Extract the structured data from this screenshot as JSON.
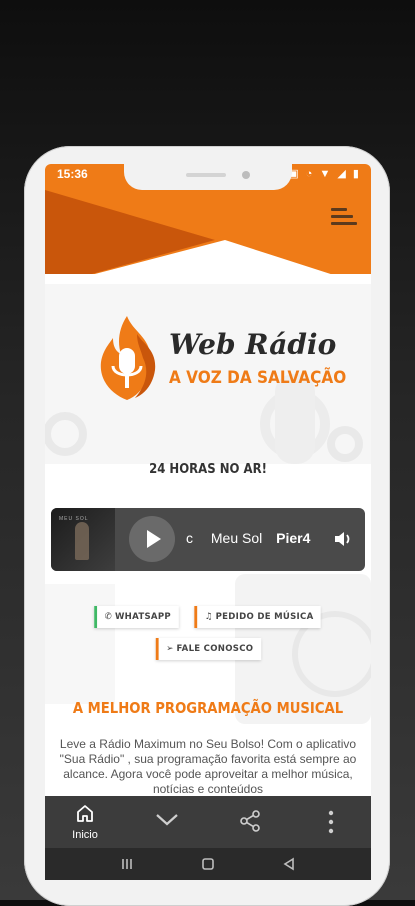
{
  "statusbar": {
    "time": "15:36",
    "icons": "▣ ◔ ▼ ◢ ▮"
  },
  "logo": {
    "title": "Web Rádio",
    "subtitle": "A VOZ DA SALVAÇÃO"
  },
  "tagline": "24 HORAS NO AR!",
  "player": {
    "album_caption": "MEU SOL",
    "track_parts": [
      "c",
      "Meu Sol",
      "Pier4"
    ]
  },
  "buttons": {
    "whatsapp": "WHATSAPP",
    "pedido": "PEDIDO DE MÚSICA",
    "fale": "FALE CONOSCO"
  },
  "section": {
    "title": "A MELHOR PROGRAMAÇÃO MUSICAL",
    "description": "Leve a Rádio Maximum no Seu Bolso! Com o aplicativo \"Sua Rádio\" , sua programação favorita está sempre ao alcance. Agora você pode aproveitar a melhor música, notícias e conteúdos"
  },
  "bottom_nav": {
    "home_label": "Inicio"
  },
  "colors": {
    "accent": "#ef7b17",
    "accent_dark": "#c9560b",
    "bar": "#3c3c3c"
  }
}
